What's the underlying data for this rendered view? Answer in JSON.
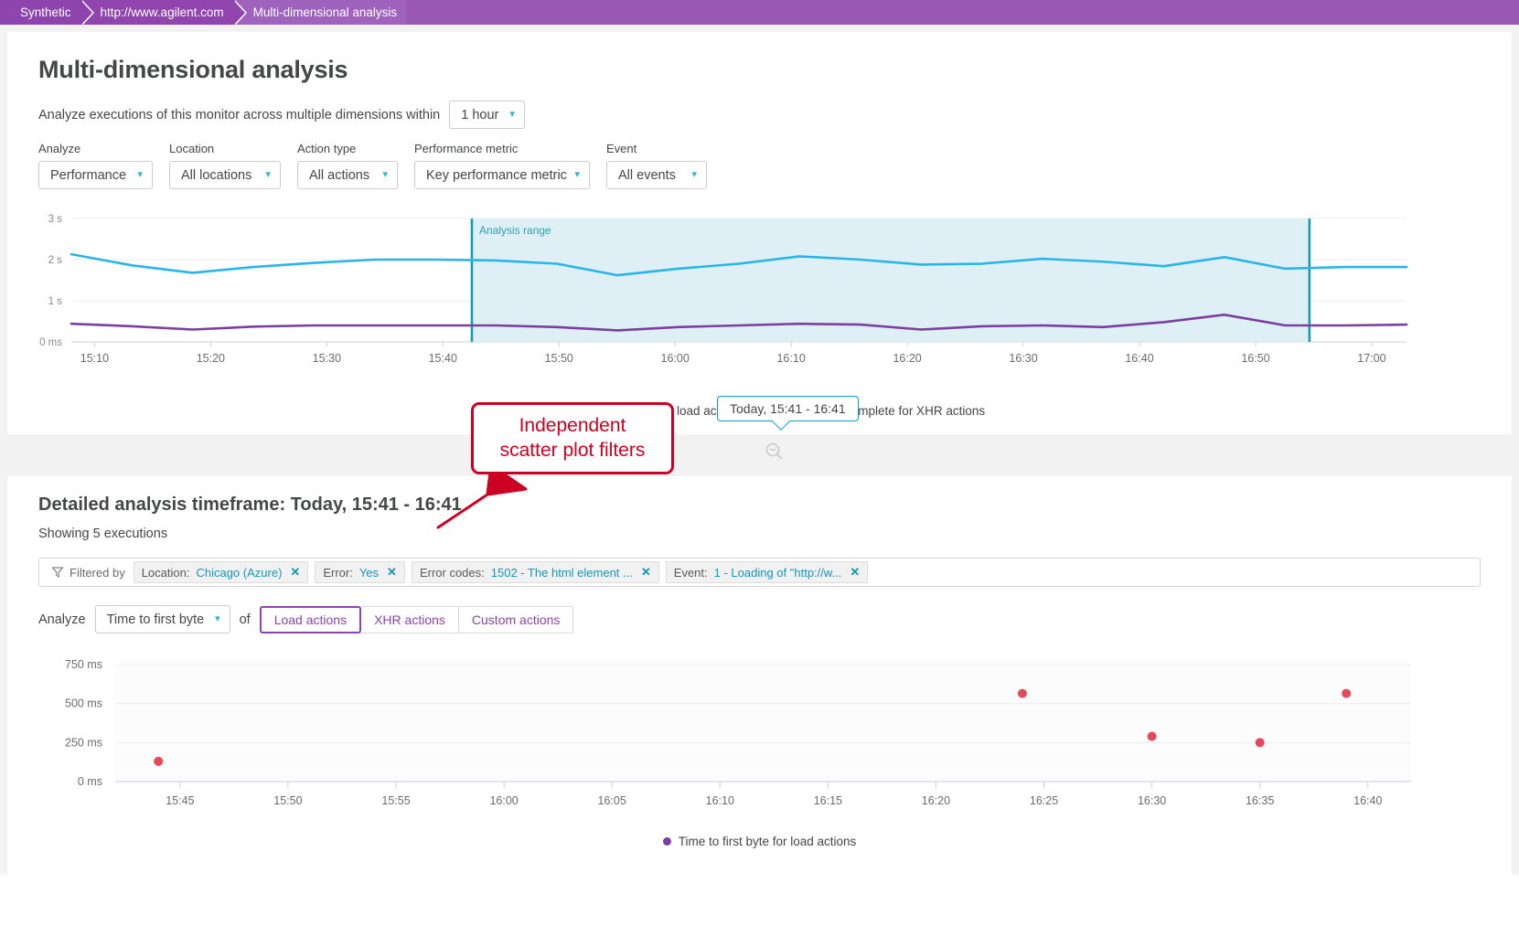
{
  "breadcrumb": {
    "items": [
      {
        "label": "Synthetic"
      },
      {
        "label": "http://www.agilent.com"
      },
      {
        "label": "Multi-dimensional analysis"
      }
    ]
  },
  "page": {
    "title": "Multi-dimensional analysis",
    "intro_text": "Analyze executions of this monitor across multiple dimensions within",
    "timeframe_value": "1 hour"
  },
  "filters": [
    {
      "label": "Analyze",
      "value": "Performance"
    },
    {
      "label": "Location",
      "value": "All locations"
    },
    {
      "label": "Action type",
      "value": "All actions"
    },
    {
      "label": "Performance metric",
      "value": "Key performance metric"
    },
    {
      "label": "Event",
      "value": "All events"
    }
  ],
  "line_chart": {
    "tooltip": "Today, 15:41 - 16:41",
    "range_label": "Analysis range",
    "legend": [
      {
        "label": "Visually complete for load actions",
        "color": "#29b5e8"
      },
      {
        "label": "Visually complete for XHR actions",
        "color": "#7b3fa0"
      }
    ]
  },
  "detail": {
    "title": "Detailed analysis timeframe: Today, 15:41 - 16:41",
    "showing": "Showing 5 executions",
    "filtered_by_label": "Filtered by",
    "chips": [
      {
        "key": "Location:",
        "value": "Chicago (Azure)"
      },
      {
        "key": "Error:",
        "value": "Yes"
      },
      {
        "key": "Error codes:",
        "value": "1502 - The html element ..."
      },
      {
        "key": "Event:",
        "value": "1 - Loading of \"http://w..."
      }
    ],
    "analyze_label": "Analyze",
    "analyze_metric": "Time to first byte",
    "of_label": "of",
    "segments": [
      {
        "label": "Load actions",
        "active": true
      },
      {
        "label": "XHR actions",
        "active": false
      },
      {
        "label": "Custom actions",
        "active": false
      }
    ]
  },
  "callout": {
    "line1": "Independent",
    "line2": "scatter plot filters",
    "color": "#cc0022"
  },
  "chart_data": [
    {
      "type": "line",
      "title": "",
      "xlabel": "",
      "ylabel": "",
      "grid": true,
      "legend_position": "bottom",
      "y_ticks": [
        "0 ms",
        "1 s",
        "2 s",
        "3 s"
      ],
      "ylim": [
        0,
        3
      ],
      "x_ticks": [
        "15:10",
        "15:20",
        "15:30",
        "15:40",
        "15:50",
        "16:00",
        "16:10",
        "16:20",
        "16:30",
        "16:40",
        "16:50",
        "17:00"
      ],
      "analysis_range": {
        "start": "15:41",
        "end": "16:41",
        "label": "Analysis range"
      },
      "series": [
        {
          "name": "Visually complete for load actions",
          "color": "#29b5e8",
          "x": [
            "15:08",
            "15:13",
            "15:18",
            "15:23",
            "15:28",
            "15:33",
            "15:38",
            "15:43",
            "15:48",
            "15:53",
            "15:58",
            "16:03",
            "16:08",
            "16:13",
            "16:18",
            "16:23",
            "16:28",
            "16:33",
            "16:38",
            "16:43",
            "16:48",
            "16:53",
            "16:58"
          ],
          "values": [
            2.13,
            1.86,
            1.68,
            1.82,
            1.92,
            2.0,
            2.0,
            1.98,
            1.9,
            1.62,
            1.78,
            1.9,
            2.08,
            2.0,
            1.88,
            1.9,
            2.02,
            1.95,
            1.84,
            2.06,
            1.78,
            1.82,
            1.82
          ]
        },
        {
          "name": "Visually complete for XHR actions",
          "color": "#7b3fa0",
          "x": [
            "15:08",
            "15:13",
            "15:18",
            "15:23",
            "15:28",
            "15:33",
            "15:38",
            "15:43",
            "15:48",
            "15:53",
            "15:58",
            "16:03",
            "16:08",
            "16:13",
            "16:18",
            "16:23",
            "16:28",
            "16:33",
            "16:38",
            "16:43",
            "16:48",
            "16:53",
            "16:58"
          ],
          "values": [
            0.44,
            0.38,
            0.3,
            0.37,
            0.4,
            0.4,
            0.4,
            0.4,
            0.36,
            0.28,
            0.36,
            0.4,
            0.44,
            0.42,
            0.3,
            0.38,
            0.4,
            0.36,
            0.48,
            0.66,
            0.4,
            0.4,
            0.42
          ]
        }
      ]
    },
    {
      "type": "scatter",
      "title": "",
      "xlabel": "",
      "ylabel": "",
      "grid": true,
      "legend_position": "bottom",
      "y_ticks": [
        "0 ms",
        "250 ms",
        "500 ms",
        "750 ms"
      ],
      "ylim": [
        0,
        750
      ],
      "x_ticks": [
        "15:45",
        "15:50",
        "15:55",
        "16:00",
        "16:05",
        "16:10",
        "16:15",
        "16:20",
        "16:25",
        "16:30",
        "16:35",
        "16:40"
      ],
      "legend": [
        {
          "label": "Time to first byte for load actions",
          "color": "#7b3fa0"
        }
      ],
      "point_color": "#e8485c",
      "points": [
        {
          "x": "15:44",
          "y": 130
        },
        {
          "x": "16:24",
          "y": 565
        },
        {
          "x": "16:30",
          "y": 290
        },
        {
          "x": "16:35",
          "y": 250
        },
        {
          "x": "16:39",
          "y": 565
        }
      ]
    }
  ]
}
